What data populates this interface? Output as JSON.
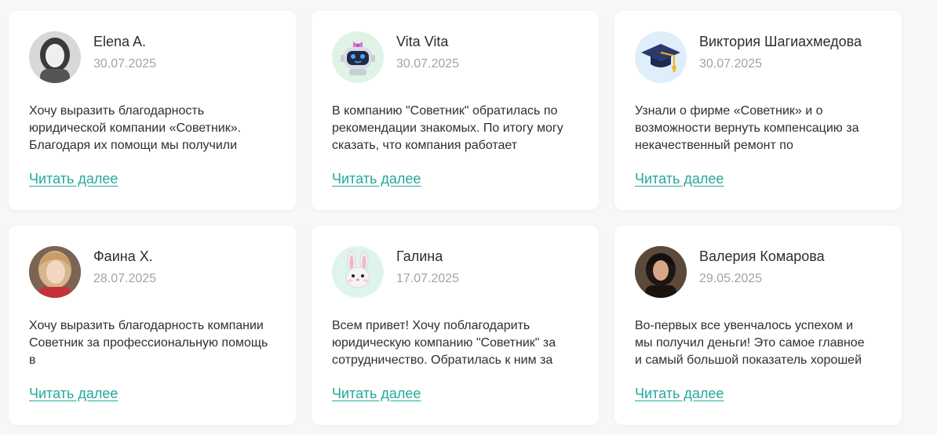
{
  "read_more_label": "Читать далее",
  "colors": {
    "accent": "#23a89a",
    "name_text": "#2d2d2d",
    "date_text": "#a3a3a3",
    "card_bg": "#ffffff",
    "page_bg": "#f7f7f7"
  },
  "reviews": [
    {
      "name": "Elena A.",
      "date": "30.07.2025",
      "avatar": "woman-photo-grayscale",
      "text": "Хочу выразить благодарность юридической компании «Советник». Благодаря их помощи мы получили"
    },
    {
      "name": "Vita Vita",
      "date": "30.07.2025",
      "avatar": "robot-icon",
      "text": "В компанию \"Советник\" обратилась по рекомендации знакомых. По итогу могу сказать, что компания работает"
    },
    {
      "name": "Виктория Шагиахмедова",
      "date": "30.07.2025",
      "avatar": "graduation-cap-icon",
      "text": "Узнали о фирме «Советник» и о возможности вернуть компенсацию за некачественный ремонт по"
    },
    {
      "name": "Фаина Х.",
      "date": "28.07.2025",
      "avatar": "woman-photo",
      "text": "Хочу выразить благодарность компании Советник за профессиональную помощь в"
    },
    {
      "name": "Галина",
      "date": "17.07.2025",
      "avatar": "rabbit-icon",
      "text": "Всем привет! Хочу поблагодарить юридическую компанию \"Советник\" за сотрудничество. Обратилась к ним за"
    },
    {
      "name": "Валерия Комарова",
      "date": "29.05.2025",
      "avatar": "woman-photo-dark",
      "text": "Во-первых все увенчалось успехом и мы получил деньги! Это самое главное и самый большой показатель хорошей"
    }
  ]
}
